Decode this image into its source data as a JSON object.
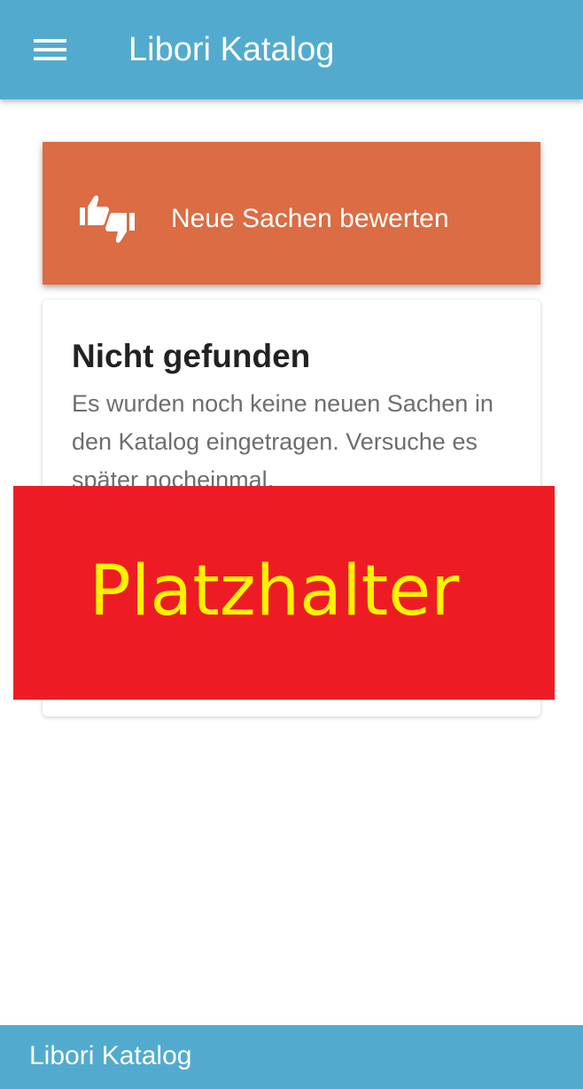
{
  "app_bar": {
    "title": "Libori Katalog",
    "menu_icon": "hamburger-menu-icon",
    "background_color": "#52abce"
  },
  "rate_card": {
    "icon": "thumbs-up-down-icon",
    "label": "Neue Sachen bewerten",
    "background_color": "#db6c43"
  },
  "info_card": {
    "title": "Nicht gefunden",
    "text": "Es wurden noch keine neuen Sachen in den Katalog eingetragen. Versuche es später nocheinmal."
  },
  "placeholder": {
    "label": "Platzhalter",
    "background_color": "#ed1c24",
    "text_color": "#fff200"
  },
  "footer": {
    "title": "Libori Katalog",
    "background_color": "#52abce"
  }
}
